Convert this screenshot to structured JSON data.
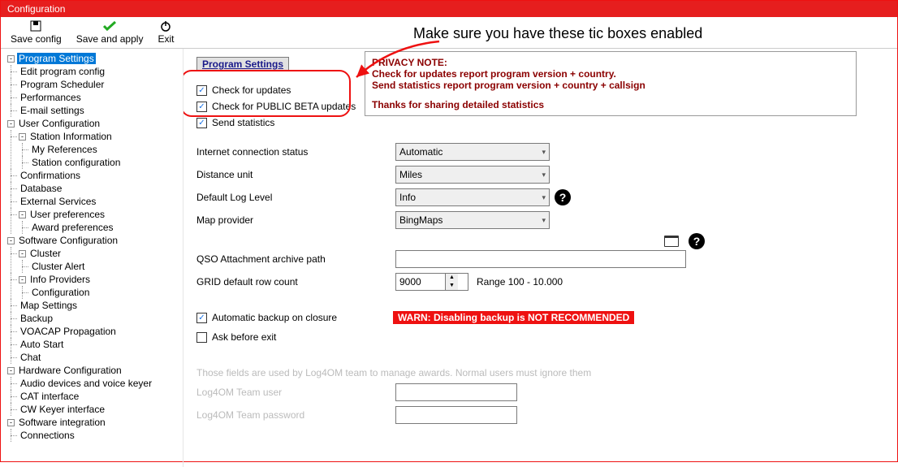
{
  "window": {
    "title": "Configuration"
  },
  "toolbar": {
    "save": "Save config",
    "apply": "Save and apply",
    "exit": "Exit"
  },
  "annotation": "Make sure you have these tic boxes enabled",
  "tree": {
    "n0": "Program Settings",
    "n0_0": "Edit program config",
    "n0_1": "Program Scheduler",
    "n0_2": "Performances",
    "n0_3": "E-mail settings",
    "n1": "User Configuration",
    "n1_0": "Station Information",
    "n1_0_0": "My References",
    "n1_0_1": "Station configuration",
    "n1_1": "Confirmations",
    "n1_2": "Database",
    "n1_3": "External Services",
    "n1_4": "User preferences",
    "n1_4_0": "Award preferences",
    "n2": "Software Configuration",
    "n2_0": "Cluster",
    "n2_0_0": "Cluster Alert",
    "n2_1": "Info Providers",
    "n2_1_0": "Configuration",
    "n2_2": "Map Settings",
    "n2_3": "Backup",
    "n2_4": "VOACAP Propagation",
    "n2_5": "Auto Start",
    "n2_6": "Chat",
    "n3": "Hardware Configuration",
    "n3_0": "Audio devices and voice keyer",
    "n3_1": "CAT interface",
    "n3_2": "CW Keyer interface",
    "n4": "Software integration",
    "n4_0": "Connections"
  },
  "panel": {
    "header": "Program Settings",
    "chk_updates": "Check for updates",
    "chk_beta": "Check for PUBLIC BETA updates",
    "chk_stats": "Send statistics",
    "privacy_title": "PRIVACY NOTE:",
    "privacy_l1": "Check for updates report program version + country.",
    "privacy_l2": "Send statistics report program version + country + callsign",
    "privacy_thanks": "Thanks for sharing detailed statistics",
    "lbl_conn": "Internet connection status",
    "val_conn": "Automatic",
    "lbl_dist": "Distance unit",
    "val_dist": "Miles",
    "lbl_log": "Default Log Level",
    "val_log": "Info",
    "lbl_map": "Map provider",
    "val_map": "BingMaps",
    "lbl_qso": "QSO Attachment archive path",
    "val_qso": "",
    "lbl_grid": "GRID default row count",
    "val_grid": "9000",
    "grid_range": "Range 100 - 10.000",
    "chk_backup": "Automatic backup on closure",
    "warn": "WARN: Disabling backup is NOT RECOMMENDED",
    "chk_ask": "Ask before exit",
    "hint": "Those fields are used by Log4OM team to manage awards. Normal users must ignore them",
    "lbl_team_user": "Log4OM Team user",
    "lbl_team_pw": "Log4OM Team password"
  }
}
